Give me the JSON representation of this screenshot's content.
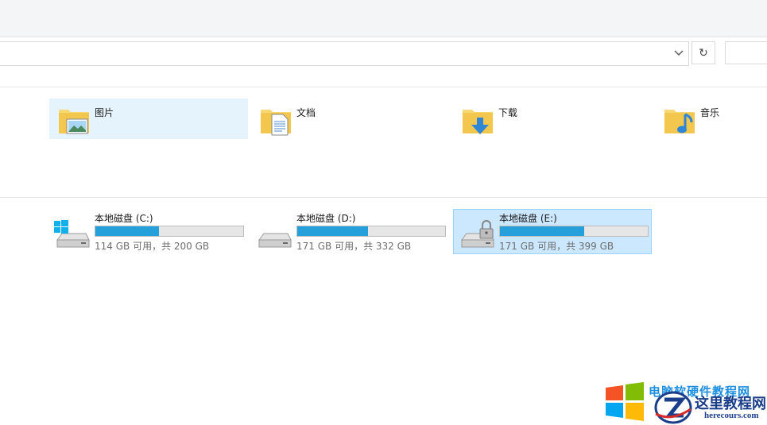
{
  "toolbar": {
    "dropdown_icon": "chevron-down-icon",
    "refresh_icon": "refresh-icon",
    "refresh_glyph": "↻",
    "dropdown_glyph": "⌵"
  },
  "folders": [
    {
      "label": "图片",
      "icon": "pictures-folder-icon",
      "selected": true
    },
    {
      "label": "文档",
      "icon": "documents-folder-icon",
      "selected": false
    },
    {
      "label": "下载",
      "icon": "downloads-folder-icon",
      "selected": false
    },
    {
      "label": "音乐",
      "icon": "music-folder-icon",
      "selected": false
    }
  ],
  "drives": [
    {
      "name": "本地磁盘 (C:)",
      "space": "114 GB 可用，共 200 GB",
      "used_fraction": 0.43,
      "icon": "windows-system-drive-icon",
      "selected": false
    },
    {
      "name": "本地磁盘 (D:)",
      "space": "171 GB 可用，共 332 GB",
      "used_fraction": 0.48,
      "icon": "hard-drive-icon",
      "selected": false
    },
    {
      "name": "本地磁盘 (E:)",
      "space": "171 GB 可用，共 399 GB",
      "used_fraction": 0.57,
      "icon": "locked-drive-icon",
      "selected": true
    }
  ],
  "colors": {
    "usage_bar": "#26a0da",
    "selection": "#cce8ff",
    "hover": "#e5f3fc",
    "folder_yellow": "#f8d775"
  },
  "watermark": {
    "line1": "电脑软硬件教程网",
    "site_cn": "这里教程网",
    "site_en": "herecours.com"
  }
}
